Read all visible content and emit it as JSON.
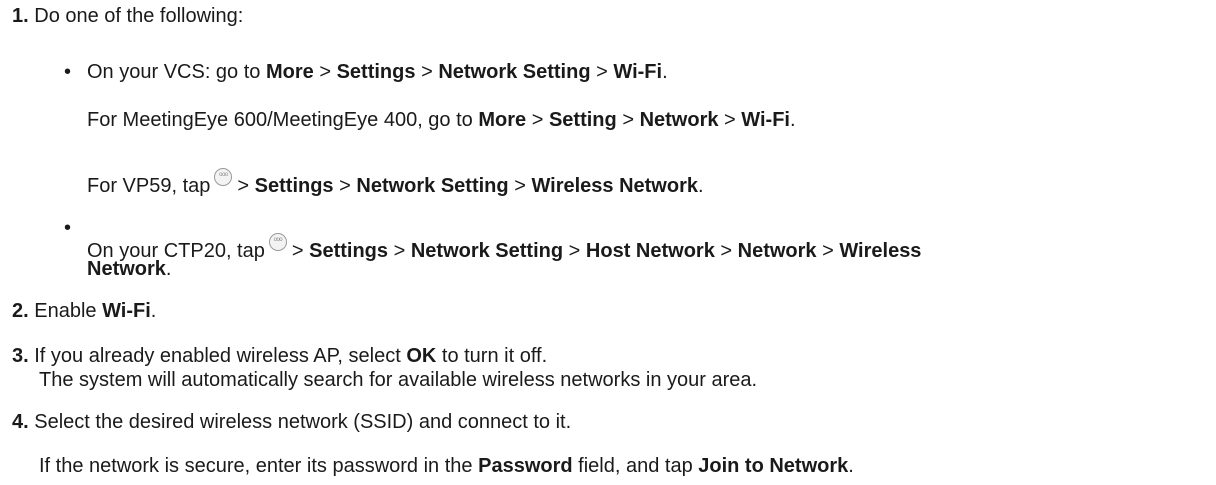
{
  "steps": [
    {
      "number": "1.",
      "text": "Do one of the following:",
      "bullets": [
        {
          "prefix": "On your VCS: go to",
          "path": [
            "More",
            "Settings",
            "Network Setting",
            "Wi-Fi"
          ],
          "alternatives": [
            {
              "prefix": "For MeetingEye 600/MeetingEye 400, go to",
              "path": [
                "More",
                "Setting",
                "Network",
                "Wi-Fi"
              ]
            },
            {
              "prefix": "For VP59, tap",
              "icon": "more-options-icon",
              "path": [
                "Settings",
                "Network Setting",
                "Wireless Network"
              ]
            }
          ]
        },
        {
          "prefix": "On your CTP20, tap",
          "icon": "more-options-icon",
          "path": [
            "Settings",
            "Network Setting",
            "Host Network",
            "Network",
            "Wireless Network"
          ]
        }
      ]
    },
    {
      "number": "2.",
      "prefix": "Enable",
      "bold": "Wi-Fi",
      "suffix": "."
    },
    {
      "number": "3.",
      "prefix": "If you already enabled wireless AP, select",
      "bold": "OK",
      "suffix": "to turn it off.",
      "note": "The system will automatically search for available wireless networks in your area."
    },
    {
      "number": "4.",
      "text": "Select the desired wireless network (SSID) and connect to it.",
      "note": {
        "prefix": "If the network is secure, enter its password in the",
        "field": "Password",
        "middle": "field, and tap",
        "action": "Join to Network",
        "suffix": "."
      }
    }
  ],
  "separator": ">",
  "period": "."
}
